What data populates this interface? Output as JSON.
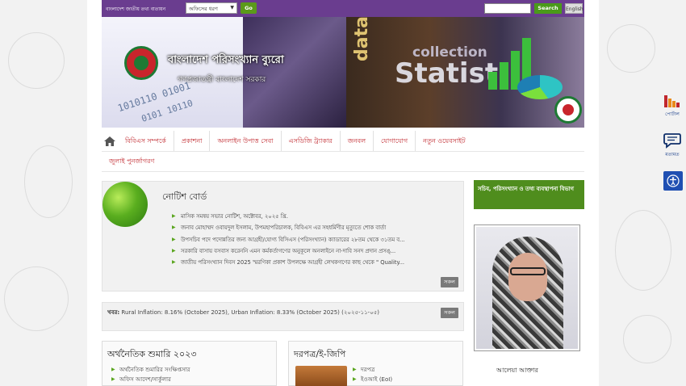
{
  "topbar": {
    "site_label": "বাংলাদেশ জাতীয় তথ্য বাতায়ন",
    "office_select": "অফিসের ধরণ",
    "go_label": "Go",
    "search_label": "Search",
    "english_label": "English"
  },
  "banner": {
    "title": "বাংলাদেশ পরিসংখ্যান ব্যুরো",
    "subtitle": "গণপ্রজাতন্ত্রী বাংলাদেশ সরকার",
    "words": {
      "statist": "Statist",
      "collection": "collection",
      "data": "data"
    }
  },
  "nav": {
    "row1": [
      "বিবিএস সম্পর্কে",
      "প্রকাশনা",
      "অনলাইন উপাত্ত সেবা",
      "এসডিজি ট্র্যাকার",
      "জনবল",
      "যোগাযোগ",
      "নতুন ওয়েবসাইট"
    ],
    "row2": [
      "জুলাই পুনর্জাগরণ"
    ]
  },
  "notice": {
    "title": "নোটিশ বোর্ড",
    "items": [
      "মাসিক সমন্বয় সভার নোটিশ, অক্টোবর, ২০২৫ খ্রি.",
      "জনাব মোহাম্মদ ওবায়দুল ইসলাম, উপমহাপরিচালক, বিবিএস এর সহধর্মিণীর মৃত্যুতে শোক বার্তা",
      "উপসচিব পদে পদোন্নতির জন্য আগ্রহী/যোগ্য বিসিএস (পরিসংখ্যান) ক্যাডারের ২৮তম থেকে ৩১তম ব...",
      "সরকারি বাসায় বসবাস করেননি এমন কর্মকর্তাগণের অনুকূলে অনলাইনে না-দাবি সনদ প্রদান প্রসঙ্...",
      "জাতীয় পরিসংখ্যান দিবস 2025 স্মরণিকা প্রকাশ উপলক্ষে আগ্রহী লেখকগণের কাছ থেকে \" Quality..."
    ],
    "all_label": "সকল"
  },
  "news": {
    "label": "খবর:",
    "text": "Rural Inflation: 8.16% (October 2025), Urban Inflation: 8.33% (October 2025) (২০২৫-১১-০৫)",
    "all_label": "সকল"
  },
  "census": {
    "title": "অর্থনৈতিক শুমারি ২০২৩",
    "items": [
      "অর্থনৈতিক শুমারির সংক্ষিপ্তসার",
      "অফিস আদেশ/সার্কুলার"
    ]
  },
  "tender": {
    "title": "দরপত্র/ই-জিপি",
    "items": [
      "দরপত্র",
      "ইওআই (EoI)"
    ]
  },
  "sidebar": {
    "secretary_title": "সচিব, পরিসংখ্যান ও তথ্য ব্যবস্থাপনা বিভাগ",
    "person_name": "আলেয়া আক্তার"
  },
  "side_tools": {
    "policy_label": "পোর্টাল",
    "feedback_label": "মতামত"
  },
  "colors": {
    "topbar": "#6a3d8f",
    "nav_text": "#c0272d",
    "accent_green": "#4f8d1d",
    "bullet_green": "#5aa51e"
  },
  "icons": [
    "home-icon",
    "bar-chart-icon",
    "speech-bubble-icon",
    "accessibility-icon",
    "globe-icon"
  ]
}
